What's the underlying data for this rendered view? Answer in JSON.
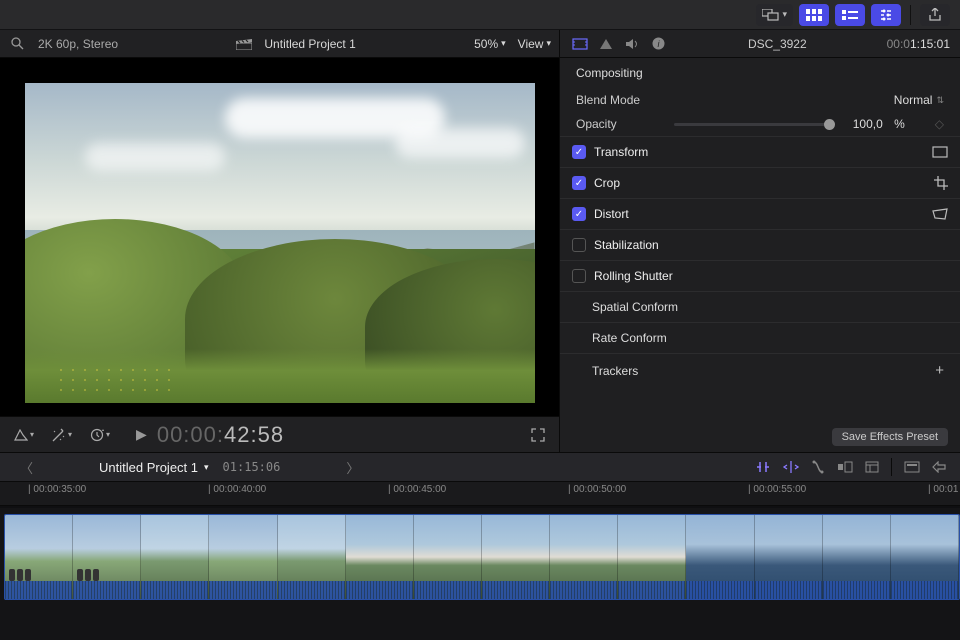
{
  "toolbar": {
    "layout": "layout",
    "grid": "grid",
    "list": "list",
    "filter": "filter",
    "share": "share"
  },
  "viewer": {
    "spec": "2K 60p, Stereo",
    "project_title": "Untitled Project 1",
    "zoom": "50%",
    "view_label": "View"
  },
  "transport": {
    "tc_small": "00:00:",
    "tc_big": "42:58"
  },
  "inspector": {
    "clip_name": "DSC_3922",
    "duration_prefix": "00:0",
    "duration_main": "1:15:01",
    "sections": {
      "compositing": "Compositing",
      "blend_mode_label": "Blend Mode",
      "blend_mode_value": "Normal",
      "opacity_label": "Opacity",
      "opacity_value": "100,0",
      "opacity_unit": "%"
    },
    "toggles": [
      {
        "label": "Transform",
        "checked": true,
        "icon": "rect"
      },
      {
        "label": "Crop",
        "checked": true,
        "icon": "crop"
      },
      {
        "label": "Distort",
        "checked": true,
        "icon": "distort"
      },
      {
        "label": "Stabilization",
        "checked": false,
        "icon": ""
      },
      {
        "label": "Rolling Shutter",
        "checked": false,
        "icon": ""
      }
    ],
    "rows": [
      {
        "label": "Spatial Conform"
      },
      {
        "label": "Rate Conform"
      },
      {
        "label": "Trackers",
        "plus": true
      }
    ],
    "save_preset": "Save Effects Preset"
  },
  "project_bar": {
    "name": "Untitled Project 1",
    "duration": "01:15:06"
  },
  "ruler": {
    "ticks": [
      "00:00:35:00",
      "00:00:40:00",
      "00:00:45:00",
      "00:00:50:00",
      "00:00:55:00",
      "00:01"
    ]
  }
}
